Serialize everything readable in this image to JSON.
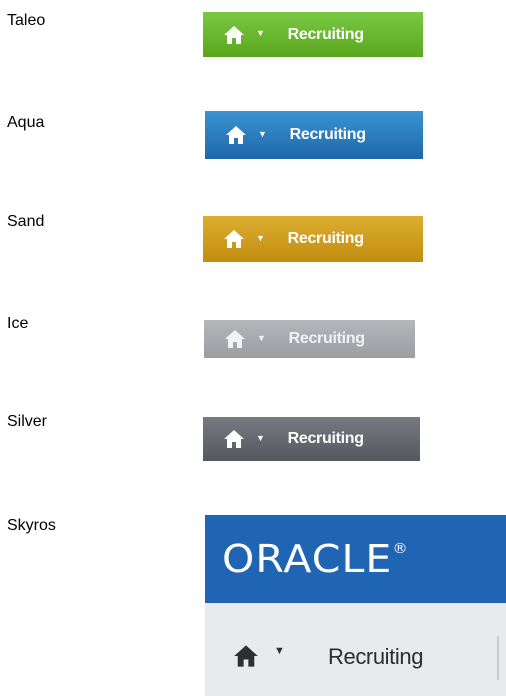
{
  "themes": [
    {
      "name": "Taleo",
      "nav_label": "Recruiting",
      "color": "#6ab630"
    },
    {
      "name": "Aqua",
      "nav_label": "Recruiting",
      "color": "#2a7cbf"
    },
    {
      "name": "Sand",
      "nav_label": "Recruiting",
      "color": "#d09e22"
    },
    {
      "name": "Ice",
      "nav_label": "Recruiting",
      "color": "#a8aaae"
    },
    {
      "name": "Silver",
      "nav_label": "Recruiting",
      "color": "#66696f"
    },
    {
      "name": "Skyros",
      "nav_label": "Recruiting",
      "color": "#1f65b3",
      "logo_text": "ORACLE",
      "logo_mark": "®"
    }
  ],
  "icons": {
    "home": "home-icon",
    "dropdown": "caret-down-icon"
  }
}
